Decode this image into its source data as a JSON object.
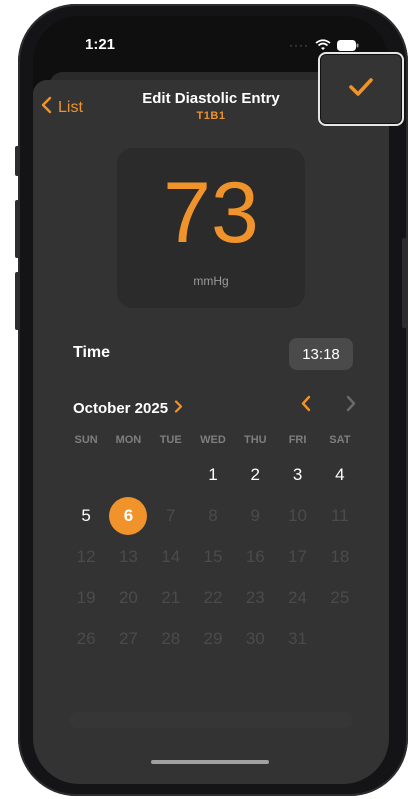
{
  "status_bar": {
    "time": "1:21",
    "signal": "····"
  },
  "nav": {
    "back_label": "List",
    "title": "Edit Diastolic Entry",
    "subtitle": "T1B1"
  },
  "reading": {
    "value": "73",
    "unit": "mmHg"
  },
  "time": {
    "label": "Time",
    "value": "13:18"
  },
  "calendar": {
    "month_label": "October 2025",
    "weekdays": [
      "SUN",
      "MON",
      "TUE",
      "WED",
      "THU",
      "FRI",
      "SAT"
    ],
    "selected_day": "6",
    "days": [
      {
        "t": "",
        "s": "empty"
      },
      {
        "t": "",
        "s": "empty"
      },
      {
        "t": "",
        "s": "empty"
      },
      {
        "t": "1",
        "s": "active"
      },
      {
        "t": "2",
        "s": "active"
      },
      {
        "t": "3",
        "s": "active"
      },
      {
        "t": "4",
        "s": "active"
      },
      {
        "t": "5",
        "s": "active"
      },
      {
        "t": "6",
        "s": "selected"
      },
      {
        "t": "7",
        "s": "disabled"
      },
      {
        "t": "8",
        "s": "disabled"
      },
      {
        "t": "9",
        "s": "disabled"
      },
      {
        "t": "10",
        "s": "disabled"
      },
      {
        "t": "11",
        "s": "disabled"
      },
      {
        "t": "12",
        "s": "disabled"
      },
      {
        "t": "13",
        "s": "disabled"
      },
      {
        "t": "14",
        "s": "disabled"
      },
      {
        "t": "15",
        "s": "disabled"
      },
      {
        "t": "16",
        "s": "disabled"
      },
      {
        "t": "17",
        "s": "disabled"
      },
      {
        "t": "18",
        "s": "disabled"
      },
      {
        "t": "19",
        "s": "disabled"
      },
      {
        "t": "20",
        "s": "disabled"
      },
      {
        "t": "21",
        "s": "disabled"
      },
      {
        "t": "22",
        "s": "disabled"
      },
      {
        "t": "23",
        "s": "disabled"
      },
      {
        "t": "24",
        "s": "disabled"
      },
      {
        "t": "25",
        "s": "disabled"
      },
      {
        "t": "26",
        "s": "disabled"
      },
      {
        "t": "27",
        "s": "disabled"
      },
      {
        "t": "28",
        "s": "disabled"
      },
      {
        "t": "29",
        "s": "disabled"
      },
      {
        "t": "30",
        "s": "disabled"
      },
      {
        "t": "31",
        "s": "disabled"
      }
    ]
  },
  "icons": {
    "done": "checkmark-icon",
    "back": "chevron-left-icon",
    "month_expand": "chevron-right-icon",
    "prev_month": "chevron-left-icon",
    "next_month": "chevron-right-icon"
  },
  "colors": {
    "accent": "#f0932b",
    "sheet": "#333333",
    "card": "#2b2b2b",
    "text_primary": "#ffffff",
    "text_disabled": "#4b4b4c"
  }
}
